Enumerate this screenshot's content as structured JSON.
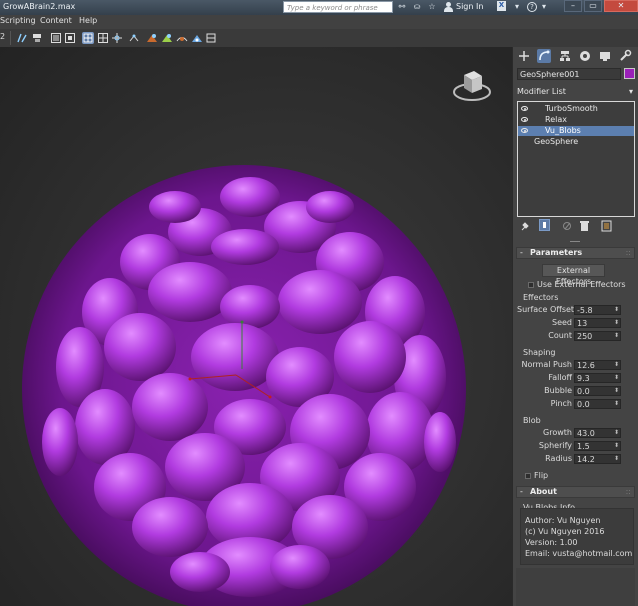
{
  "window": {
    "title": "GrowABrain2.max",
    "search_placeholder": "Type a keyword or phrase",
    "sign_in": "Sign In",
    "close_x": "X",
    "help_q": "?"
  },
  "menu": [
    "Scripting",
    "Content",
    "Help"
  ],
  "toolbar": {
    "left_digit": "2"
  },
  "colors": {
    "blob": "#9b1fc0",
    "object_color": "#9a1fb8",
    "selection": "#5c7fb0",
    "panel": "#444444"
  },
  "panel": {
    "tabs": [
      "create-icon",
      "modify-icon",
      "hierarchy-icon",
      "motion-icon",
      "display-icon",
      "utilities-icon"
    ],
    "object_name": "GeoSphere001",
    "modifier_list_label": "Modifier List",
    "stack": [
      {
        "label": "TurboSmooth",
        "visible": true,
        "selected": false
      },
      {
        "label": "Relax",
        "visible": true,
        "selected": false
      },
      {
        "label": "Vu_Blobs",
        "visible": true,
        "selected": true
      },
      {
        "label": "GeoSphere",
        "visible": false,
        "selected": false
      }
    ],
    "parameters": {
      "title": "Parameters",
      "toggle": "-",
      "external_effectors_button": "External Effectors",
      "use_external_effectors": "Use External Effectors",
      "effectors_group": "Effectors",
      "effectors": [
        {
          "label": "Surface Offset",
          "value": "-5.8"
        },
        {
          "label": "Seed",
          "value": "13"
        },
        {
          "label": "Count",
          "value": "250"
        }
      ],
      "shaping_group": "Shaping",
      "shaping": [
        {
          "label": "Normal Push",
          "value": "12.6"
        },
        {
          "label": "Falloff",
          "value": "9.3"
        },
        {
          "label": "Bubble",
          "value": "0.0"
        },
        {
          "label": "Pinch",
          "value": "0.0"
        }
      ],
      "blob_group": "Blob",
      "blob": [
        {
          "label": "Growth",
          "value": "43.0"
        },
        {
          "label": "Spherify",
          "value": "1.5"
        },
        {
          "label": "Radius",
          "value": "14.2"
        }
      ],
      "flip": "Flip"
    },
    "about": {
      "title": "About",
      "toggle": "-",
      "group": "Vu Blobs Info",
      "lines": [
        "Author: Vu Nguyen",
        "(c) Vu Nguyen 2016",
        "Version: 1.00",
        "Email: vusta@hotmail.com"
      ]
    }
  }
}
